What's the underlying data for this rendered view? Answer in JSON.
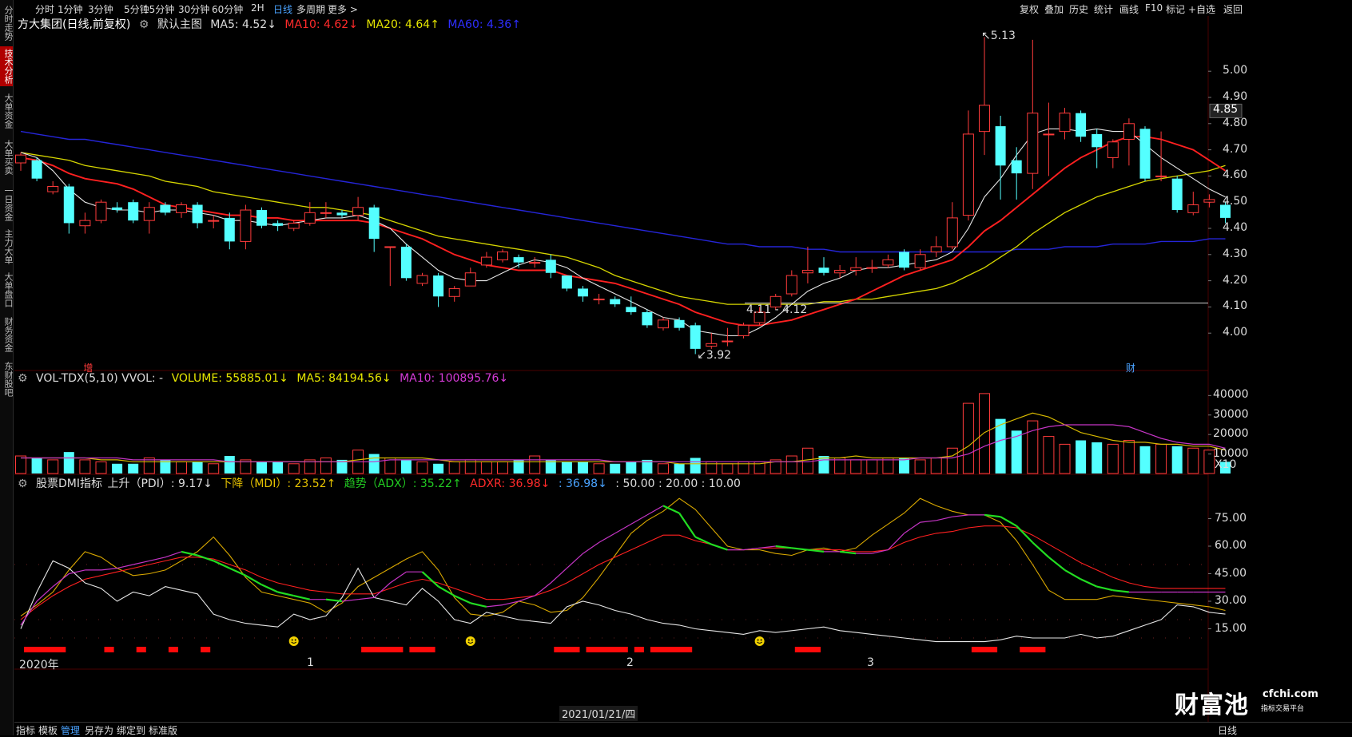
{
  "left_tabs": [
    {
      "label": "分时走势",
      "active": false
    },
    {
      "label": "技术分析",
      "active": true
    },
    {
      "label": "大单资金",
      "active": false
    },
    {
      "label": "大单买卖",
      "active": false
    },
    {
      "label": "一日资金",
      "active": false
    },
    {
      "label": "主力大单",
      "active": false
    },
    {
      "label": "大单盘口",
      "active": false
    },
    {
      "label": "财务资金",
      "active": false
    },
    {
      "label": "东财股吧",
      "active": false
    }
  ],
  "periods": [
    "分时",
    "1分钟",
    "3分钟",
    "5分钟",
    "15分钟",
    "30分钟",
    "60分钟",
    "2H",
    "日线",
    "多周期",
    "更多 >"
  ],
  "active_period": "日线",
  "toolbar_right": [
    "复权",
    "叠加",
    "历史",
    "统计",
    "画线",
    "F10",
    "标记",
    "+自选",
    "返回"
  ],
  "main_legend": {
    "stock": "方大集团(日线,前复权)",
    "main_label": "默认主图",
    "ma5": "MA5: 4.52↓",
    "ma10": "MA10: 4.62↓",
    "ma20": "MA20: 4.64↑",
    "ma60": "MA60: 4.36↑"
  },
  "price_axis": [
    "5.00",
    "4.90",
    "4.80",
    "4.70",
    "4.60",
    "4.50",
    "4.40",
    "4.30",
    "4.20",
    "4.10",
    "4.00"
  ],
  "current_price": "4.85",
  "annotations": {
    "high": "5.13",
    "low": "3.92",
    "range": "4.11 - 4.12"
  },
  "markers": {
    "left": "增",
    "right": "财"
  },
  "vol_legend": {
    "name": "VOL-TDX(5,10) VVOL: -",
    "volume": "VOLUME: 55885.01↓",
    "ma5": "MA5: 84194.56↓",
    "ma10": "MA10: 100895.76↓"
  },
  "vol_axis": [
    "40000",
    "30000",
    "20000",
    "10000"
  ],
  "vol_unit": "X10",
  "dmi_legend": {
    "name": "股票DMI指标",
    "pdi": "上升（PDI）: 9.17↓",
    "mdi": "下降（MDI）: 23.52↑",
    "adx": "趋势（ADX）: 35.22↑",
    "adxr": "ADXR: 36.98↓",
    "extra": ": 36.98↓",
    "levels": ": 50.00 : 20.00 : 10.00"
  },
  "dmi_axis": [
    "75.00",
    "60.00",
    "45.00",
    "30.00",
    "15.00"
  ],
  "x_labels": [
    "2020年",
    "1",
    "2",
    "3"
  ],
  "date_box": "2021/01/21/四",
  "bottom_tools": [
    "指标",
    "模板",
    "管理",
    "另存为",
    "绑定到",
    "标准版"
  ],
  "active_bottom": "管理",
  "watermark": {
    "name": "财富池",
    "url": "cfchi.com",
    "sub": "指标交易平台"
  },
  "bottom_right": "日线",
  "chart_data": {
    "type": "candlestick",
    "title": "方大集团(日线,前复权)",
    "price_ylim": [
      3.9,
      5.15
    ],
    "candles": [
      {
        "o": 4.65,
        "c": 4.68,
        "h": 4.69,
        "l": 4.62
      },
      {
        "o": 4.66,
        "c": 4.59,
        "h": 4.67,
        "l": 4.58
      },
      {
        "o": 4.54,
        "c": 4.56,
        "h": 4.58,
        "l": 4.53
      },
      {
        "o": 4.56,
        "c": 4.42,
        "h": 4.57,
        "l": 4.38
      },
      {
        "o": 4.41,
        "c": 4.43,
        "h": 4.46,
        "l": 4.38
      },
      {
        "o": 4.43,
        "c": 4.5,
        "h": 4.51,
        "l": 4.42
      },
      {
        "o": 4.48,
        "c": 4.47,
        "h": 4.5,
        "l": 4.46
      },
      {
        "o": 4.5,
        "c": 4.43,
        "h": 4.51,
        "l": 4.42
      },
      {
        "o": 4.43,
        "c": 4.48,
        "h": 4.5,
        "l": 4.38
      },
      {
        "o": 4.49,
        "c": 4.46,
        "h": 4.5,
        "l": 4.45
      },
      {
        "o": 4.46,
        "c": 4.49,
        "h": 4.5,
        "l": 4.44
      },
      {
        "o": 4.49,
        "c": 4.42,
        "h": 4.5,
        "l": 4.4
      },
      {
        "o": 4.43,
        "c": 4.43,
        "h": 4.45,
        "l": 4.4
      },
      {
        "o": 4.44,
        "c": 4.35,
        "h": 4.46,
        "l": 4.32
      },
      {
        "o": 4.35,
        "c": 4.47,
        "h": 4.49,
        "l": 4.32
      },
      {
        "o": 4.47,
        "c": 4.41,
        "h": 4.48,
        "l": 4.4
      },
      {
        "o": 4.42,
        "c": 4.41,
        "h": 4.43,
        "l": 4.39
      },
      {
        "o": 4.4,
        "c": 4.42,
        "h": 4.43,
        "l": 4.39
      },
      {
        "o": 4.42,
        "c": 4.46,
        "h": 4.5,
        "l": 4.41
      },
      {
        "o": 4.46,
        "c": 4.46,
        "h": 4.5,
        "l": 4.44
      },
      {
        "o": 4.46,
        "c": 4.45,
        "h": 4.47,
        "l": 4.44
      },
      {
        "o": 4.45,
        "c": 4.48,
        "h": 4.52,
        "l": 4.43
      },
      {
        "o": 4.48,
        "c": 4.36,
        "h": 4.49,
        "l": 4.31
      },
      {
        "o": 4.33,
        "c": 4.33,
        "h": 4.33,
        "l": 4.18
      },
      {
        "o": 4.33,
        "c": 4.21,
        "h": 4.34,
        "l": 4.2
      },
      {
        "o": 4.19,
        "c": 4.22,
        "h": 4.23,
        "l": 4.18
      },
      {
        "o": 4.22,
        "c": 4.14,
        "h": 4.23,
        "l": 4.1
      },
      {
        "o": 4.14,
        "c": 4.17,
        "h": 4.18,
        "l": 4.12
      },
      {
        "o": 4.18,
        "c": 4.23,
        "h": 4.25,
        "l": 4.18
      },
      {
        "o": 4.26,
        "c": 4.29,
        "h": 4.31,
        "l": 4.25
      },
      {
        "o": 4.28,
        "c": 4.31,
        "h": 4.32,
        "l": 4.27
      },
      {
        "o": 4.29,
        "c": 4.27,
        "h": 4.3,
        "l": 4.25
      },
      {
        "o": 4.27,
        "c": 4.27,
        "h": 4.29,
        "l": 4.25
      },
      {
        "o": 4.28,
        "c": 4.23,
        "h": 4.3,
        "l": 4.21
      },
      {
        "o": 4.22,
        "c": 4.17,
        "h": 4.22,
        "l": 4.16
      },
      {
        "o": 4.17,
        "c": 4.14,
        "h": 4.18,
        "l": 4.12
      },
      {
        "o": 4.13,
        "c": 4.13,
        "h": 4.15,
        "l": 4.11
      },
      {
        "o": 4.13,
        "c": 4.11,
        "h": 4.14,
        "l": 4.1
      },
      {
        "o": 4.1,
        "c": 4.08,
        "h": 4.14,
        "l": 4.07
      },
      {
        "o": 4.08,
        "c": 4.03,
        "h": 4.09,
        "l": 4.02
      },
      {
        "o": 4.02,
        "c": 4.05,
        "h": 4.06,
        "l": 4.01
      },
      {
        "o": 4.05,
        "c": 4.02,
        "h": 4.06,
        "l": 4.01
      },
      {
        "o": 4.03,
        "c": 3.94,
        "h": 4.04,
        "l": 3.92
      },
      {
        "o": 3.95,
        "c": 3.96,
        "h": 4.0,
        "l": 3.94
      },
      {
        "o": 3.97,
        "c": 3.97,
        "h": 4.02,
        "l": 3.95
      },
      {
        "o": 3.99,
        "c": 4.03,
        "h": 4.04,
        "l": 3.98
      },
      {
        "o": 4.04,
        "c": 4.08,
        "h": 4.1,
        "l": 4.03
      },
      {
        "o": 4.1,
        "c": 4.14,
        "h": 4.15,
        "l": 4.09
      },
      {
        "o": 4.15,
        "c": 4.22,
        "h": 4.24,
        "l": 4.14
      },
      {
        "o": 4.23,
        "c": 4.24,
        "h": 4.33,
        "l": 4.19
      },
      {
        "o": 4.25,
        "c": 4.23,
        "h": 4.29,
        "l": 4.22
      },
      {
        "o": 4.23,
        "c": 4.24,
        "h": 4.26,
        "l": 4.21
      },
      {
        "o": 4.24,
        "c": 4.25,
        "h": 4.29,
        "l": 4.22
      },
      {
        "o": 4.25,
        "c": 4.25,
        "h": 4.28,
        "l": 4.23
      },
      {
        "o": 4.26,
        "c": 4.28,
        "h": 4.3,
        "l": 4.25
      },
      {
        "o": 4.31,
        "c": 4.25,
        "h": 4.32,
        "l": 4.24
      },
      {
        "o": 4.25,
        "c": 4.3,
        "h": 4.32,
        "l": 4.24
      },
      {
        "o": 4.31,
        "c": 4.33,
        "h": 4.37,
        "l": 4.29
      },
      {
        "o": 4.33,
        "c": 4.44,
        "h": 4.5,
        "l": 4.32
      },
      {
        "o": 4.45,
        "c": 4.76,
        "h": 4.85,
        "l": 4.43
      },
      {
        "o": 4.77,
        "c": 4.87,
        "h": 5.13,
        "l": 4.68
      },
      {
        "o": 4.79,
        "c": 4.64,
        "h": 4.83,
        "l": 4.51
      },
      {
        "o": 4.66,
        "c": 4.61,
        "h": 4.71,
        "l": 4.51
      },
      {
        "o": 4.61,
        "c": 4.84,
        "h": 5.12,
        "l": 4.55
      },
      {
        "o": 4.76,
        "c": 4.76,
        "h": 4.88,
        "l": 4.6
      },
      {
        "o": 4.77,
        "c": 4.84,
        "h": 4.86,
        "l": 4.74
      },
      {
        "o": 4.84,
        "c": 4.75,
        "h": 4.85,
        "l": 4.73
      },
      {
        "o": 4.76,
        "c": 4.71,
        "h": 4.78,
        "l": 4.63
      },
      {
        "o": 4.67,
        "c": 4.73,
        "h": 4.74,
        "l": 4.63
      },
      {
        "o": 4.74,
        "c": 4.8,
        "h": 4.82,
        "l": 4.64
      },
      {
        "o": 4.78,
        "c": 4.59,
        "h": 4.79,
        "l": 4.58
      },
      {
        "o": 4.6,
        "c": 4.6,
        "h": 4.77,
        "l": 4.58
      },
      {
        "o": 4.59,
        "c": 4.47,
        "h": 4.6,
        "l": 4.46
      },
      {
        "o": 4.46,
        "c": 4.49,
        "h": 4.54,
        "l": 4.45
      },
      {
        "o": 4.5,
        "c": 4.51,
        "h": 4.53,
        "l": 4.48
      },
      {
        "o": 4.49,
        "c": 4.44,
        "h": 4.5,
        "l": 4.42
      }
    ],
    "ma5": [
      4.69,
      4.67,
      4.62,
      4.55,
      4.5,
      4.48,
      4.47,
      4.47,
      4.46,
      4.47,
      4.47,
      4.46,
      4.45,
      4.43,
      4.43,
      4.42,
      4.41,
      4.42,
      4.43,
      4.44,
      4.44,
      4.45,
      4.43,
      4.4,
      4.34,
      4.29,
      4.24,
      4.21,
      4.2,
      4.2,
      4.23,
      4.26,
      4.28,
      4.27,
      4.25,
      4.21,
      4.18,
      4.15,
      4.12,
      4.09,
      4.06,
      4.05,
      4.01,
      4.0,
      3.99,
      3.99,
      4.02,
      4.06,
      4.11,
      4.16,
      4.19,
      4.21,
      4.24,
      4.25,
      4.25,
      4.26,
      4.27,
      4.28,
      4.31,
      4.4,
      4.52,
      4.59,
      4.68,
      4.76,
      4.78,
      4.78,
      4.77,
      4.78,
      4.77,
      4.77,
      4.72,
      4.67,
      4.63,
      4.59,
      4.55,
      4.52
    ],
    "ma10": [
      4.67,
      4.66,
      4.64,
      4.61,
      4.59,
      4.58,
      4.57,
      4.55,
      4.52,
      4.49,
      4.48,
      4.47,
      4.46,
      4.45,
      4.45,
      4.44,
      4.44,
      4.43,
      4.43,
      4.43,
      4.43,
      4.43,
      4.42,
      4.4,
      4.38,
      4.36,
      4.33,
      4.3,
      4.28,
      4.26,
      4.25,
      4.24,
      4.24,
      4.24,
      4.22,
      4.21,
      4.2,
      4.19,
      4.17,
      4.15,
      4.13,
      4.11,
      4.08,
      4.06,
      4.04,
      4.03,
      4.03,
      4.04,
      4.05,
      4.07,
      4.09,
      4.11,
      4.13,
      4.16,
      4.19,
      4.22,
      4.24,
      4.26,
      4.28,
      4.33,
      4.39,
      4.43,
      4.48,
      4.53,
      4.58,
      4.63,
      4.67,
      4.7,
      4.73,
      4.75,
      4.75,
      4.74,
      4.72,
      4.7,
      4.66,
      4.62
    ],
    "ma20": [
      4.69,
      4.68,
      4.67,
      4.66,
      4.64,
      4.63,
      4.62,
      4.61,
      4.6,
      4.58,
      4.57,
      4.56,
      4.54,
      4.53,
      4.52,
      4.51,
      4.5,
      4.49,
      4.48,
      4.48,
      4.47,
      4.46,
      4.45,
      4.43,
      4.41,
      4.39,
      4.37,
      4.36,
      4.35,
      4.34,
      4.33,
      4.32,
      4.31,
      4.3,
      4.29,
      4.27,
      4.25,
      4.22,
      4.2,
      4.18,
      4.16,
      4.14,
      4.13,
      4.12,
      4.11,
      4.11,
      4.11,
      4.11,
      4.11,
      4.11,
      4.12,
      4.12,
      4.13,
      4.13,
      4.14,
      4.15,
      4.16,
      4.17,
      4.19,
      4.22,
      4.25,
      4.29,
      4.33,
      4.38,
      4.42,
      4.46,
      4.49,
      4.52,
      4.54,
      4.56,
      4.58,
      4.59,
      4.6,
      4.61,
      4.62,
      4.64
    ],
    "ma60": [
      4.77,
      4.76,
      4.75,
      4.74,
      4.74,
      4.73,
      4.72,
      4.71,
      4.7,
      4.69,
      4.68,
      4.67,
      4.66,
      4.65,
      4.64,
      4.63,
      4.62,
      4.61,
      4.6,
      4.59,
      4.58,
      4.57,
      4.56,
      4.55,
      4.54,
      4.53,
      4.52,
      4.51,
      4.5,
      4.49,
      4.48,
      4.47,
      4.46,
      4.45,
      4.44,
      4.43,
      4.42,
      4.41,
      4.4,
      4.39,
      4.38,
      4.37,
      4.36,
      4.35,
      4.34,
      4.34,
      4.33,
      4.33,
      4.33,
      4.32,
      4.32,
      4.31,
      4.31,
      4.31,
      4.31,
      4.31,
      4.31,
      4.31,
      4.31,
      4.31,
      4.31,
      4.31,
      4.32,
      4.32,
      4.32,
      4.33,
      4.33,
      4.33,
      4.34,
      4.34,
      4.34,
      4.35,
      4.35,
      4.35,
      4.36,
      4.36
    ],
    "volume": [
      900,
      800,
      700,
      1100,
      700,
      600,
      500,
      500,
      800,
      700,
      600,
      600,
      500,
      900,
      700,
      600,
      600,
      500,
      700,
      800,
      700,
      1200,
      1000,
      800,
      700,
      600,
      500,
      600,
      700,
      600,
      600,
      700,
      900,
      700,
      600,
      600,
      500,
      500,
      600,
      700,
      500,
      500,
      800,
      600,
      500,
      600,
      600,
      700,
      900,
      1300,
      900,
      800,
      700,
      700,
      800,
      800,
      700,
      800,
      1300,
      3600,
      4100,
      2800,
      2200,
      2700,
      1900,
      1500,
      1700,
      1600,
      1500,
      1700,
      1400,
      1500,
      1400,
      1300,
      1200,
      600
    ],
    "vol_ma5": [
      800,
      800,
      800,
      800,
      800,
      700,
      700,
      600,
      600,
      600,
      600,
      600,
      600,
      600,
      600,
      600,
      600,
      600,
      600,
      600,
      600,
      700,
      800,
      800,
      800,
      800,
      700,
      600,
      600,
      600,
      600,
      600,
      600,
      600,
      600,
      600,
      600,
      600,
      600,
      600,
      600,
      500,
      500,
      500,
      500,
      500,
      500,
      600,
      600,
      700,
      800,
      800,
      900,
      800,
      800,
      800,
      800,
      800,
      900,
      1400,
      2100,
      2500,
      2800,
      3100,
      2900,
      2500,
      2100,
      1900,
      1700,
      1600,
      1600,
      1500,
      1500,
      1400,
      1400,
      1200
    ],
    "vol_ma10": [
      800,
      800,
      800,
      800,
      800,
      800,
      800,
      700,
      700,
      700,
      700,
      700,
      700,
      600,
      600,
      600,
      600,
      600,
      600,
      600,
      600,
      600,
      600,
      700,
      700,
      700,
      700,
      700,
      700,
      700,
      700,
      700,
      700,
      700,
      700,
      700,
      700,
      600,
      600,
      600,
      600,
      600,
      600,
      600,
      600,
      600,
      600,
      600,
      600,
      600,
      700,
      700,
      700,
      700,
      700,
      700,
      800,
      800,
      800,
      1000,
      1400,
      1700,
      1900,
      2200,
      2400,
      2500,
      2500,
      2500,
      2500,
      2400,
      2100,
      1800,
      1600,
      1500,
      1500,
      1300
    ],
    "pdi": [
      15,
      35,
      52,
      48,
      40,
      37,
      30,
      35,
      33,
      38,
      36,
      34,
      23,
      20,
      18,
      17,
      16,
      23,
      20,
      22,
      32,
      48,
      32,
      30,
      28,
      37,
      30,
      20,
      18,
      24,
      22,
      20,
      19,
      18,
      27,
      30,
      28,
      25,
      23,
      20,
      18,
      17,
      15,
      14,
      13,
      12,
      14,
      13,
      14,
      15,
      16,
      14,
      13,
      12,
      11,
      10,
      9,
      8,
      8,
      8,
      8,
      9,
      11,
      10,
      10,
      10,
      12,
      10,
      11,
      14,
      17,
      20,
      28,
      27,
      24,
      23
    ],
    "mdi": [
      22,
      28,
      35,
      47,
      57,
      54,
      48,
      44,
      45,
      47,
      52,
      57,
      65,
      55,
      43,
      35,
      33,
      31,
      29,
      24,
      29,
      38,
      43,
      48,
      53,
      57,
      47,
      32,
      23,
      22,
      24,
      30,
      28,
      24,
      25,
      32,
      43,
      55,
      67,
      74,
      79,
      86,
      80,
      70,
      60,
      58,
      58,
      56,
      55,
      58,
      59,
      57,
      59,
      66,
      72,
      78,
      86,
      82,
      79,
      77,
      77,
      73,
      63,
      50,
      36,
      31,
      31,
      31,
      33,
      32,
      31,
      30,
      29,
      28,
      27,
      25
    ],
    "adx": [
      17,
      30,
      38,
      45,
      47,
      47,
      48,
      50,
      52,
      54,
      57,
      55,
      52,
      48,
      44,
      39,
      35,
      33,
      31,
      31,
      30,
      31,
      32,
      40,
      46,
      46,
      38,
      33,
      29,
      27,
      28,
      30,
      33,
      40,
      48,
      56,
      62,
      67,
      72,
      77,
      82,
      78,
      65,
      61,
      58,
      58,
      59,
      60,
      59,
      58,
      57,
      57,
      56,
      56,
      58,
      67,
      73,
      74,
      76,
      77,
      77,
      76,
      71,
      62,
      54,
      47,
      42,
      38,
      36,
      35,
      35,
      35,
      35,
      35,
      35,
      35
    ],
    "adxr": [
      20,
      27,
      33,
      38,
      42,
      44,
      46,
      48,
      50,
      52,
      54,
      54,
      53,
      50,
      47,
      43,
      40,
      38,
      36,
      35,
      34,
      34,
      34,
      37,
      40,
      42,
      40,
      37,
      34,
      31,
      31,
      32,
      33,
      36,
      40,
      45,
      50,
      54,
      58,
      62,
      66,
      66,
      63,
      61,
      58,
      58,
      59,
      59,
      59,
      58,
      58,
      58,
      57,
      57,
      58,
      62,
      65,
      67,
      68,
      70,
      71,
      71,
      70,
      66,
      61,
      56,
      51,
      47,
      43,
      40,
      38,
      37,
      37,
      37,
      37,
      37
    ]
  }
}
